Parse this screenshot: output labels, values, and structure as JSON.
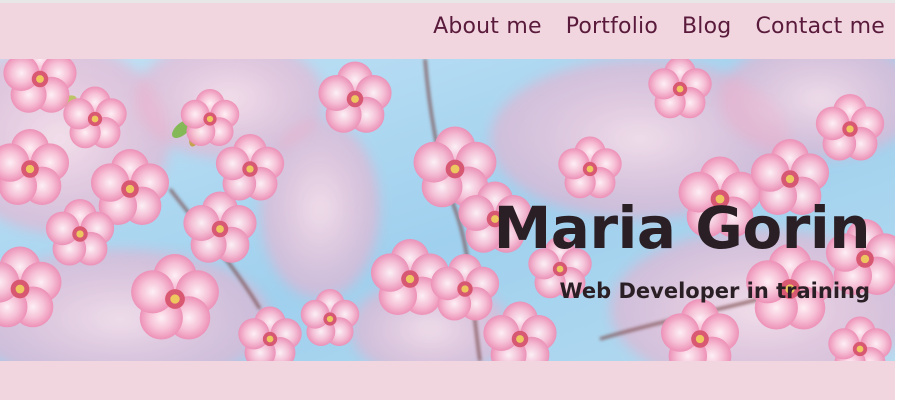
{
  "nav": {
    "items": [
      {
        "label": "About me"
      },
      {
        "label": "Portfolio"
      },
      {
        "label": "Blog"
      },
      {
        "label": "Contact me"
      }
    ]
  },
  "hero": {
    "title": "Maria Gorin",
    "subtitle": "Web Developer in training"
  },
  "colors": {
    "page_background": "#f1d6df",
    "nav_text": "#5a1a3b",
    "hero_text": "#2a1f24",
    "sky": "#9ccfeb",
    "blossom": "#f4a9c7"
  }
}
